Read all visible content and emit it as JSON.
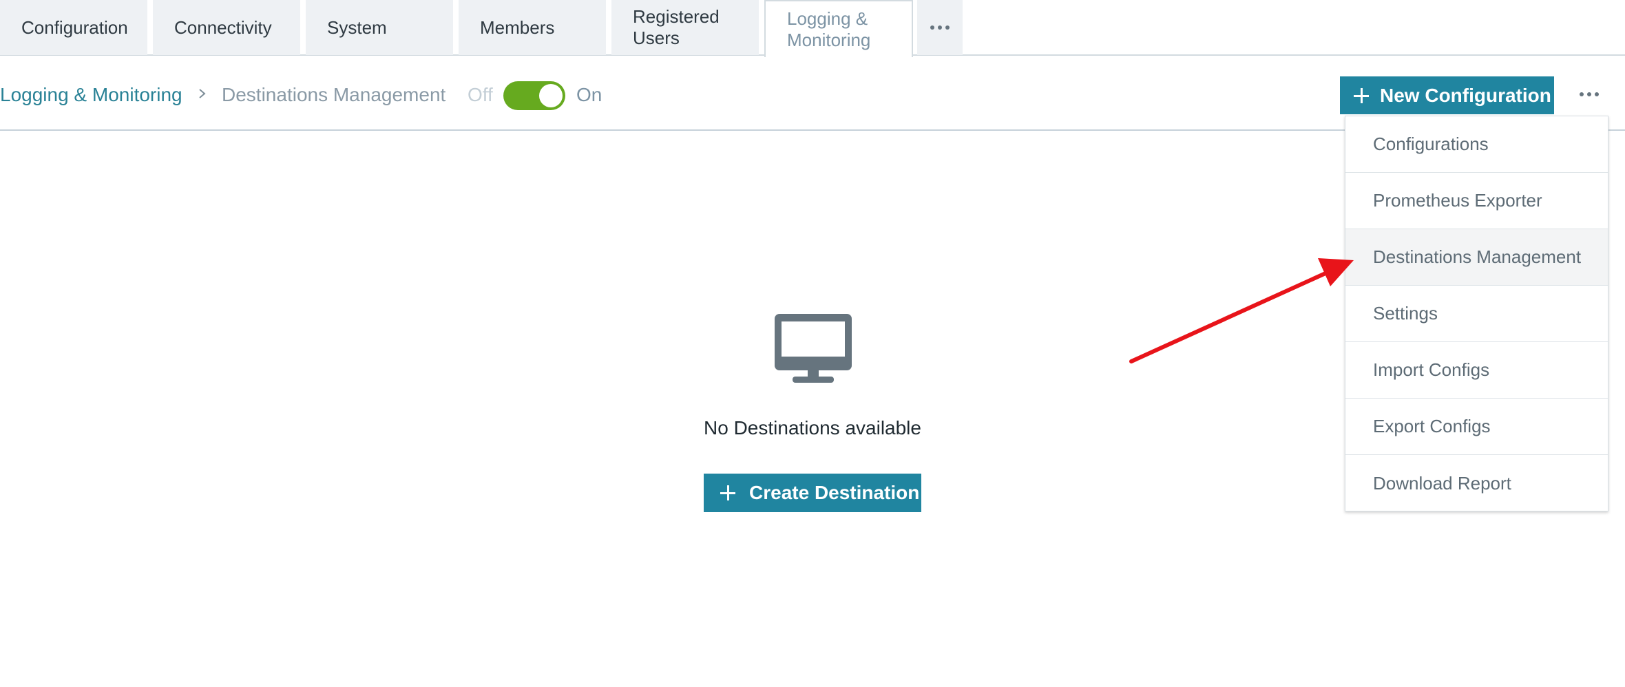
{
  "tabs": [
    {
      "label": "Configuration"
    },
    {
      "label": "Connectivity"
    },
    {
      "label": "System"
    },
    {
      "label": "Members"
    },
    {
      "label": "Registered Users"
    },
    {
      "label": "Logging & Monitoring",
      "active": true
    }
  ],
  "tabs_more_icon": "more-horizontal-icon",
  "breadcrumb": {
    "parent": "Logging & Monitoring",
    "separator_icon": "chevron-right-icon",
    "current": "Destinations Management"
  },
  "toggle": {
    "off_label": "Off",
    "on_label": "On",
    "state": "on",
    "color": "#66aa1f"
  },
  "toolbar": {
    "new_config_label": "New Configuration",
    "more_icon": "more-horizontal-icon"
  },
  "menu": {
    "items": [
      {
        "label": "Configurations"
      },
      {
        "label": "Prometheus Exporter"
      },
      {
        "label": "Destinations Management",
        "highlighted": true
      },
      {
        "label": "Settings"
      },
      {
        "label": "Import Configs"
      },
      {
        "label": "Export Configs"
      },
      {
        "label": "Download Report"
      }
    ]
  },
  "empty_state": {
    "icon": "monitor-icon",
    "message": "No Destinations available",
    "button_label": "Create Destination"
  },
  "colors": {
    "accent": "#2085a0",
    "link": "#2a8296",
    "annotation": "#e8141a"
  }
}
